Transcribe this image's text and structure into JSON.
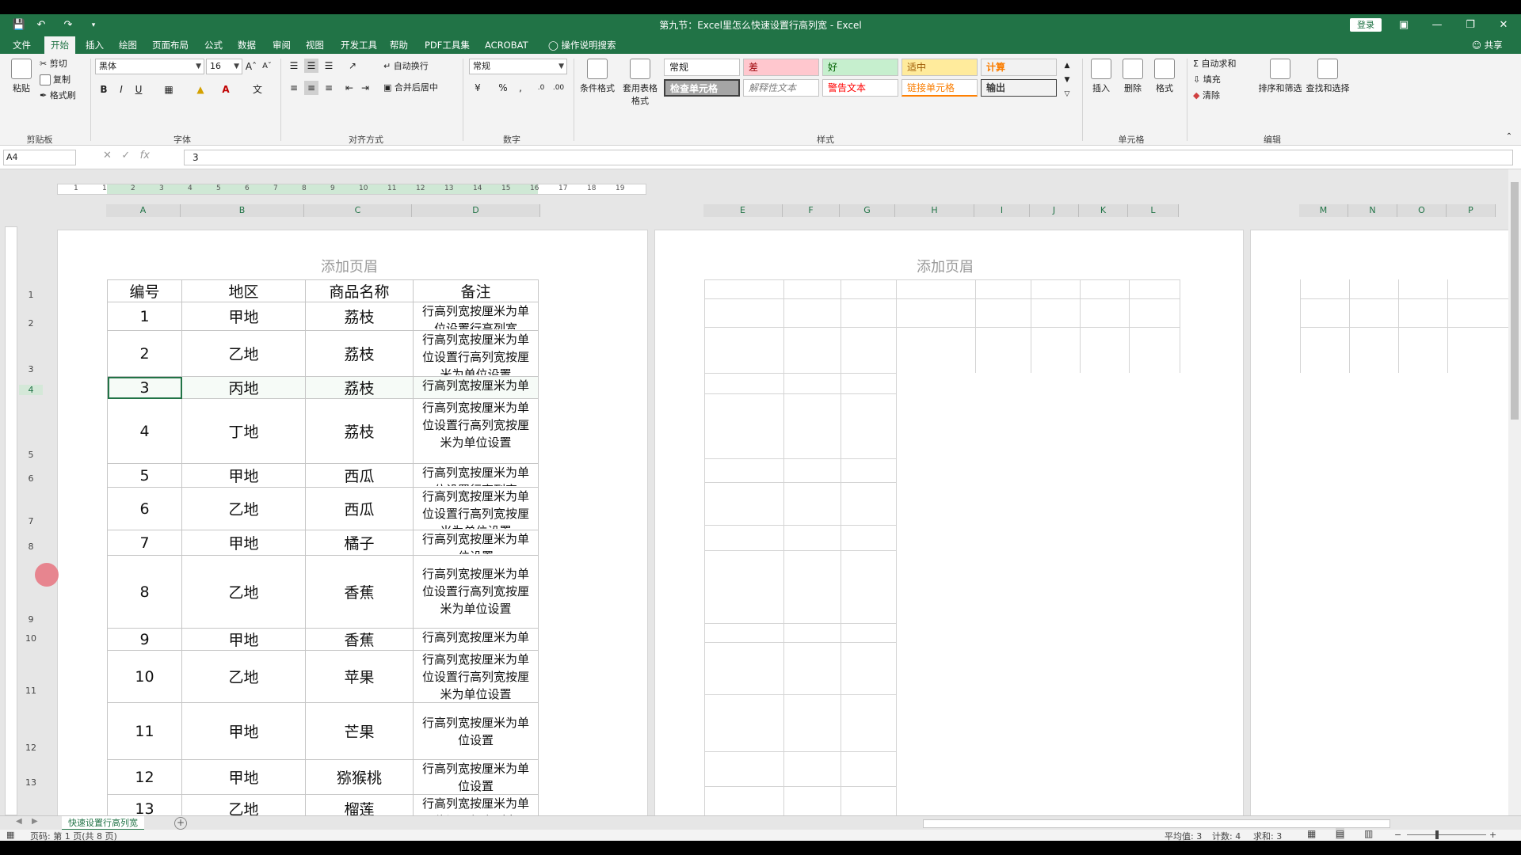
{
  "titlebar": {
    "title": "第九节：Excel里怎么快速设置行高列宽 - Excel",
    "login": "登录"
  },
  "menu": [
    "文件",
    "开始",
    "插入",
    "绘图",
    "页面布局",
    "公式",
    "数据",
    "审阅",
    "视图",
    "开发工具",
    "帮助",
    "PDF工具集",
    "ACROBAT",
    "操作说明搜索"
  ],
  "share": "共享",
  "ribbon": {
    "clipboard": {
      "paste": "粘贴",
      "cut": "剪切",
      "copy": "复制",
      "format_painter": "格式刷",
      "label": "剪贴板"
    },
    "font": {
      "name": "黑体",
      "size": "16",
      "label": "字体"
    },
    "align": {
      "wrap": "自动换行",
      "merge": "合并后居中",
      "label": "对齐方式"
    },
    "number": {
      "format": "常规",
      "label": "数字"
    },
    "styles": {
      "cond": "条件格式",
      "table": "套用表格格式",
      "cells": [
        "常规",
        "差",
        "好",
        "适中",
        "计算",
        "检查单元格",
        "解释性文本",
        "警告文本",
        "链接单元格",
        "输出"
      ],
      "label": "样式"
    },
    "cells": {
      "insert": "插入",
      "delete": "删除",
      "format": "格式",
      "label": "单元格"
    },
    "editing": {
      "autosum": "自动求和",
      "fill": "填充",
      "clear": "清除",
      "sort": "排序和筛选",
      "find": "查找和选择",
      "label": "编辑"
    }
  },
  "formula": {
    "namebox": "A4",
    "value": "3"
  },
  "ruler_ticks": [
    "1",
    "1",
    "2",
    "3",
    "4",
    "5",
    "6",
    "7",
    "8",
    "9",
    "10",
    "11",
    "12",
    "13",
    "14",
    "15",
    "16",
    "17",
    "18",
    "19"
  ],
  "columns_page1": [
    "A",
    "B",
    "C",
    "D"
  ],
  "columns_page2": [
    "E",
    "F",
    "G",
    "H",
    "I",
    "J",
    "K",
    "L"
  ],
  "columns_page3": [
    "M",
    "N",
    "O",
    "P"
  ],
  "row_numbers": [
    "1",
    "2",
    "3",
    "4",
    "5",
    "6",
    "7",
    "8",
    "9",
    "10",
    "11",
    "12",
    "13"
  ],
  "header_hint": "添加页眉",
  "table": {
    "headers": [
      "编号",
      "地区",
      "商品名称",
      "备注"
    ],
    "rows": [
      {
        "id": "1",
        "region": "甲地",
        "product": "荔枝",
        "note": "行高列宽按厘米为单位设置行高列宽"
      },
      {
        "id": "2",
        "region": "乙地",
        "product": "荔枝",
        "note": "行高列宽按厘米为单位设置行高列宽按厘米为单位设置"
      },
      {
        "id": "3",
        "region": "丙地",
        "product": "荔枝",
        "note": "行高列宽按厘米为单位设置行高列宽"
      },
      {
        "id": "4",
        "region": "丁地",
        "product": "荔枝",
        "note": "行高列宽按厘米为单位设置行高列宽按厘米为单位设置"
      },
      {
        "id": "5",
        "region": "甲地",
        "product": "西瓜",
        "note": "行高列宽按厘米为单位设置行高列宽"
      },
      {
        "id": "6",
        "region": "乙地",
        "product": "西瓜",
        "note": "行高列宽按厘米为单位设置行高列宽按厘米为单位设置"
      },
      {
        "id": "7",
        "region": "甲地",
        "product": "橘子",
        "note": "行高列宽按厘米为单位设置"
      },
      {
        "id": "8",
        "region": "乙地",
        "product": "香蕉",
        "note": "行高列宽按厘米为单位设置行高列宽按厘米为单位设置"
      },
      {
        "id": "9",
        "region": "甲地",
        "product": "香蕉",
        "note": "行高列宽按厘米为单位设置"
      },
      {
        "id": "10",
        "region": "乙地",
        "product": "苹果",
        "note": "行高列宽按厘米为单位设置行高列宽按厘米为单位设置"
      },
      {
        "id": "11",
        "region": "甲地",
        "product": "芒果",
        "note": "行高列宽按厘米为单位设置"
      },
      {
        "id": "12",
        "region": "甲地",
        "product": "猕猴桃",
        "note": "行高列宽按厘米为单位设置"
      },
      {
        "id": "13",
        "region": "乙地",
        "product": "榴莲",
        "note": "行高列宽按厘米为单位设置行高列宽"
      }
    ]
  },
  "sheet_tab": "快速设置行高列宽",
  "status": {
    "page": "页码: 第 1 页(共 8 页)",
    "average": "平均值: 3",
    "count": "计数: 4",
    "sum": "求和: 3"
  }
}
